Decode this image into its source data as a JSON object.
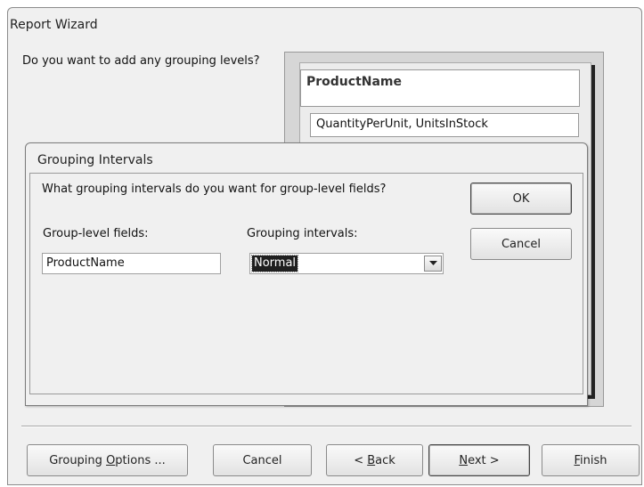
{
  "wizard": {
    "title": "Report Wizard",
    "question": "Do you want to add any grouping levels?",
    "preview": {
      "group_field": "ProductName",
      "detail_fields": "QuantityPerUnit, UnitsInStock"
    },
    "buttons": {
      "grouping_options": {
        "before": "Grouping ",
        "mnemonic": "O",
        "after": "ptions ..."
      },
      "cancel": "Cancel",
      "back": {
        "before": "< ",
        "mnemonic": "B",
        "after": "ack"
      },
      "next": {
        "before": "",
        "mnemonic": "N",
        "after": "ext >"
      },
      "finish": {
        "before": "",
        "mnemonic": "F",
        "after": "inish"
      }
    }
  },
  "dialog": {
    "title": "Grouping Intervals",
    "prompt": "What grouping intervals do you want for group-level fields?",
    "group_fields_label": "Group-level fields:",
    "intervals_label": "Grouping intervals:",
    "group_field_value": "ProductName",
    "interval_value": "Normal",
    "ok_label": "OK",
    "cancel_label": "Cancel",
    "dropdown_icon": "chevron-down-icon"
  }
}
